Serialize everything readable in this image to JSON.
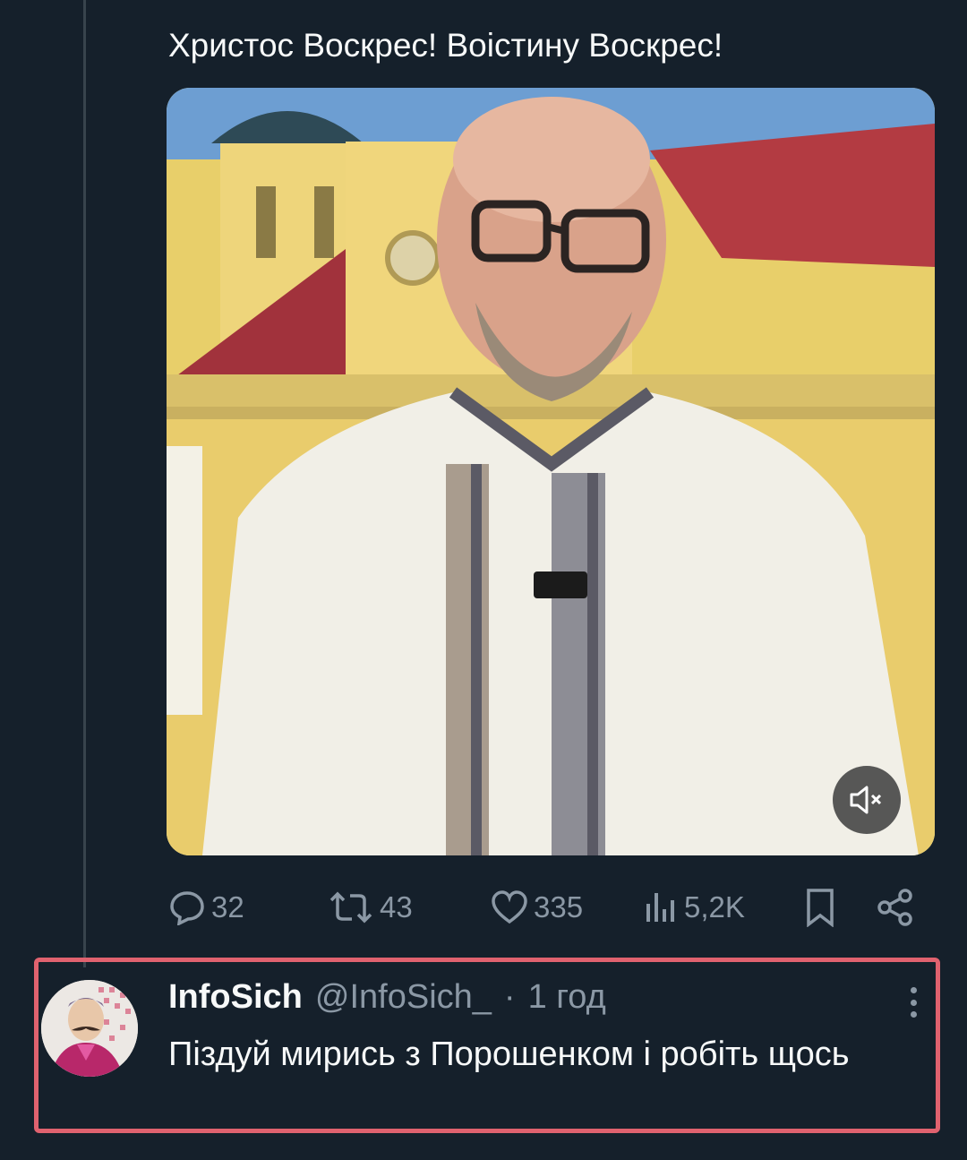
{
  "tweet": {
    "text": "Христос Воскрес! Воістину Воскрес!"
  },
  "media": {
    "type": "video",
    "mute_icon": "speaker-muted-icon"
  },
  "actions": {
    "reply_count": "32",
    "retweet_count": "43",
    "like_count": "335",
    "views_count": "5,2K",
    "icons": [
      "reply-icon",
      "retweet-icon",
      "like-icon",
      "views-icon",
      "bookmark-icon",
      "share-icon"
    ]
  },
  "reply": {
    "name": "InfoSich",
    "handle": "@InfoSich_",
    "separator": "·",
    "time": "1 год",
    "text": "Піздуй мирись з Порошенком і робіть щось"
  },
  "colors": {
    "background": "#15202b",
    "text": "#e7e9ea",
    "muted": "#8b98a5",
    "highlight_border": "#e0626f"
  }
}
